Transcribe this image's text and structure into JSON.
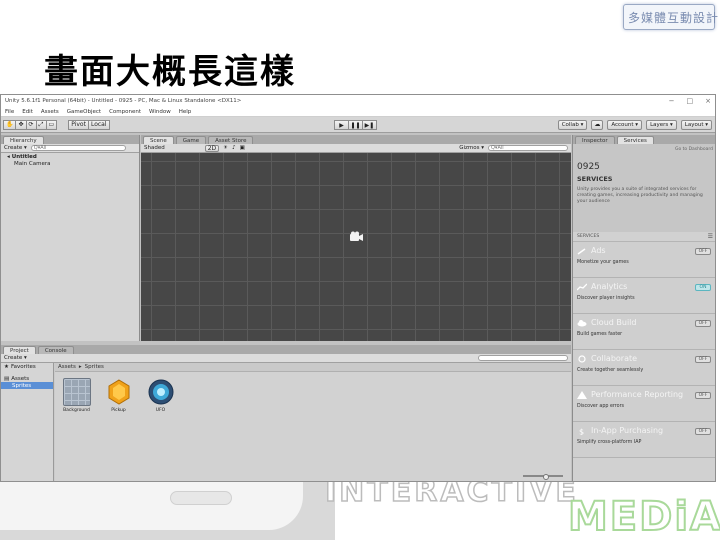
{
  "slide": {
    "title": "畫面大概長這樣",
    "badge": "多媒體互動設計"
  },
  "watermark": {
    "interactive": "INTERACTIVE",
    "media": "MEDiA"
  },
  "editor": {
    "window_title": "Unity 5.6.1f1 Personal (64bit) - Untitled - 0925 - PC, Mac & Linux Standalone <DX11>",
    "window_controls": [
      "−",
      "□",
      "×"
    ],
    "menu": [
      "File",
      "Edit",
      "Assets",
      "GameObject",
      "Component",
      "Window",
      "Help"
    ],
    "toolbar": {
      "tools": [
        "✋",
        "✥",
        "⟳",
        "⤢",
        "▭"
      ],
      "pivot": "Pivot",
      "local": "Local",
      "play": [
        "▶",
        "❚❚",
        "▶❚"
      ],
      "collab": "Collab ▾",
      "account": "Account ▾",
      "layers": "Layers ▾",
      "layout": "Layout ▾"
    },
    "hierarchy": {
      "tab": "Hierarchy",
      "create": "Create ▾",
      "search": "Q▾All",
      "scene": "Untitled",
      "children": [
        "Main Camera"
      ]
    },
    "scene_view": {
      "tabs": [
        "Scene",
        "Game",
        "Asset Store"
      ],
      "shading": "Shaded",
      "mode_2d": "2D",
      "gizmos": "Gizmos ▾",
      "search": "Q▾All"
    },
    "project": {
      "tabs": [
        "Project",
        "Console"
      ],
      "create": "Create ▾",
      "favorites": "Favorites",
      "assets": "Assets",
      "folders": [
        "Sprites"
      ],
      "breadcrumb": [
        "Assets",
        "Sprites"
      ],
      "items": [
        {
          "name": "Background",
          "icon": "background-sprite-icon"
        },
        {
          "name": "Pickup",
          "icon": "pickup-sprite-icon"
        },
        {
          "name": "UFO",
          "icon": "ufo-sprite-icon"
        }
      ]
    },
    "services": {
      "tabs": [
        "Inspector",
        "Services"
      ],
      "go_to_dashboard": "Go to Dashboard",
      "project_name": "0925",
      "heading": "SERVICES",
      "description": "Unity provides you a suite of integrated services for creating games, increasing productivity and managing your audience",
      "section_label": "SERVICES",
      "list": [
        {
          "name": "Ads",
          "subtitle": "Monetize your games",
          "status": "OFF",
          "icon": "ads-icon"
        },
        {
          "name": "Analytics",
          "subtitle": "Discover player insights",
          "status": "ON",
          "icon": "analytics-icon"
        },
        {
          "name": "Cloud Build",
          "subtitle": "Build games faster",
          "status": "OFF",
          "icon": "cloud-build-icon"
        },
        {
          "name": "Collaborate",
          "subtitle": "Create together seamlessly",
          "status": "OFF",
          "icon": "collaborate-icon"
        },
        {
          "name": "Performance Reporting",
          "subtitle": "Discover app errors",
          "status": "OFF",
          "icon": "performance-icon"
        },
        {
          "name": "In-App Purchasing",
          "subtitle": "Simplify cross-platform IAP",
          "status": "OFF",
          "icon": "iap-icon"
        }
      ]
    }
  },
  "colors": {
    "scene_bg": "#474747",
    "panel": "#d5d5d5",
    "selection": "#5a8fd6",
    "toggle_on": "#2a8a94"
  }
}
